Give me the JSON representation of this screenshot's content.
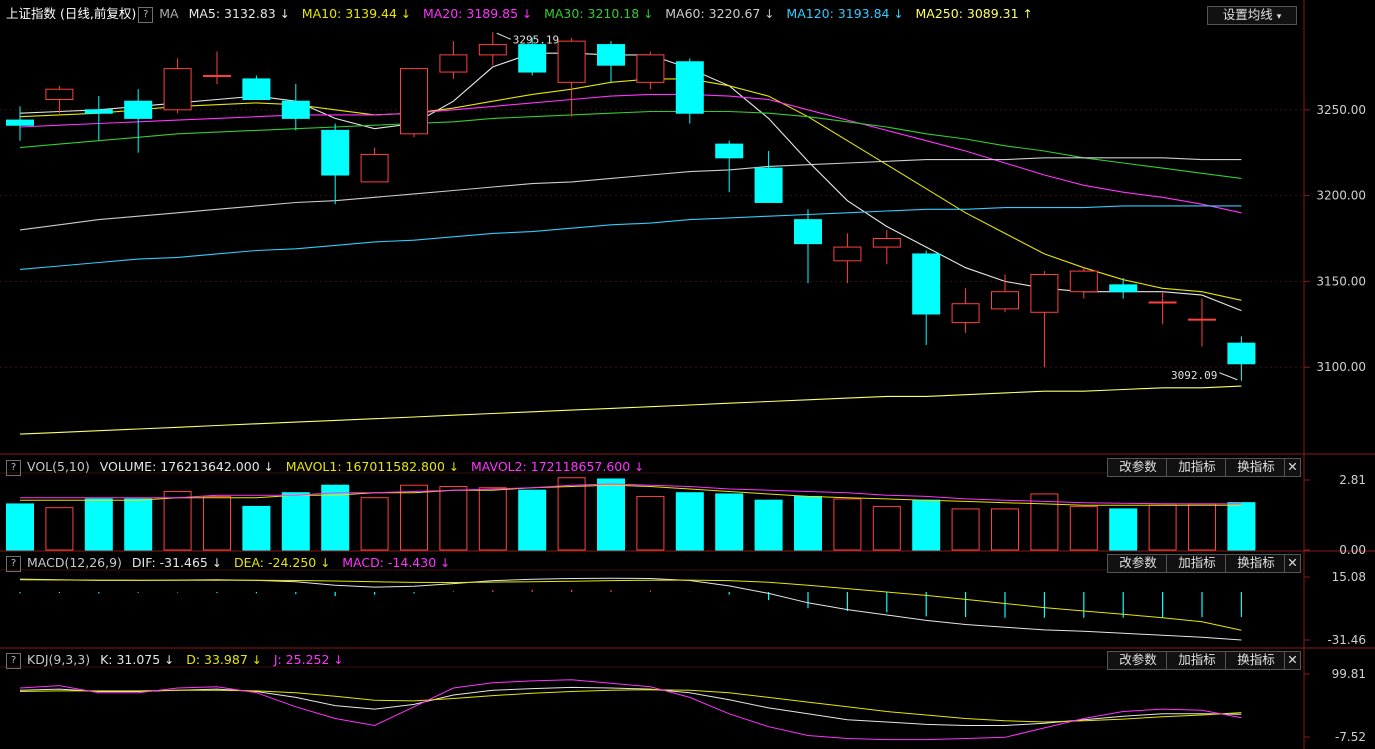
{
  "main": {
    "title": "上证指数",
    "subtitle": "(日线,前复权)",
    "ma_label": "MA",
    "ma_items": [
      {
        "label": "MA5: 3132.83",
        "arrow": "↓",
        "color": "#e6e6e6"
      },
      {
        "label": "MA10: 3139.44",
        "arrow": "↓",
        "color": "#e6e600"
      },
      {
        "label": "MA20: 3189.85",
        "arrow": "↓",
        "color": "#ff33ff"
      },
      {
        "label": "MA30: 3210.18",
        "arrow": "↓",
        "color": "#33cc33"
      },
      {
        "label": "MA60: 3220.67",
        "arrow": "↓",
        "color": "#cccccc"
      },
      {
        "label": "MA120: 3193.84",
        "arrow": "↓",
        "color": "#33ccff"
      },
      {
        "label": "MA250: 3089.31",
        "arrow": "↑",
        "color": "#ffff66"
      }
    ],
    "settings_button": "设置均线",
    "help_mark": "?"
  },
  "vol_panel": {
    "name": "VOL(5,10)",
    "items": [
      {
        "label": "VOLUME: 176213642.000",
        "arrow": "↓",
        "color": "#e6e6e6"
      },
      {
        "label": "MAVOL1: 167011582.800",
        "arrow": "↓",
        "color": "#e6e600"
      },
      {
        "label": "MAVOL2: 172118657.600",
        "arrow": "↓",
        "color": "#ff33ff"
      }
    ]
  },
  "macd_panel": {
    "name": "MACD(12,26,9)",
    "items": [
      {
        "label": "DIF: -31.465",
        "arrow": "↓",
        "color": "#e6e6e6"
      },
      {
        "label": "DEA: -24.250",
        "arrow": "↓",
        "color": "#e6e600"
      },
      {
        "label": "MACD: -14.430",
        "arrow": "↓",
        "color": "#ff33ff"
      }
    ]
  },
  "kdj_panel": {
    "name": "KDJ(9,3,3)",
    "items": [
      {
        "label": "K: 31.075",
        "arrow": "↓",
        "color": "#e6e6e6"
      },
      {
        "label": "D: 33.987",
        "arrow": "↓",
        "color": "#e6e600"
      },
      {
        "label": "J: 25.252",
        "arrow": "↓",
        "color": "#ff33ff"
      }
    ]
  },
  "panel_buttons": {
    "param": "改参数",
    "add": "加指标",
    "switch": "换指标",
    "close": "✕"
  },
  "colors": {
    "up": "#ff4040",
    "down": "#00ffff",
    "grid": "#3a1010",
    "axis": "#8b1a1a"
  },
  "chart_data": [
    {
      "type": "candlestick",
      "title": "上证指数 (日线,前复权)",
      "ylim": [
        3050,
        3300
      ],
      "y_ticks": [
        "3250.00",
        "3200.00",
        "3150.00",
        "3100.00"
      ],
      "y_tick_values": [
        3250,
        3200,
        3150,
        3100
      ],
      "annotations": [
        {
          "text": "3295.19",
          "index": 12,
          "value": 3295.19
        },
        {
          "text": "3092.09",
          "index": 31,
          "value": 3092.09
        }
      ],
      "ohlc": [
        [
          3244,
          3252,
          3232,
          3241
        ],
        [
          3256,
          3264,
          3248,
          3262
        ],
        [
          3250,
          3258,
          3232,
          3248
        ],
        [
          3255,
          3262,
          3225,
          3245
        ],
        [
          3250,
          3280,
          3248,
          3274
        ],
        [
          3270,
          3284,
          3265,
          3270
        ],
        [
          3268,
          3270,
          3258,
          3256
        ],
        [
          3255,
          3265,
          3238,
          3245
        ],
        [
          3238,
          3242,
          3195,
          3212
        ],
        [
          3208,
          3228,
          3208,
          3224
        ],
        [
          3236,
          3274,
          3234,
          3274
        ],
        [
          3272,
          3290,
          3268,
          3282
        ],
        [
          3282,
          3295.19,
          3276,
          3288
        ],
        [
          3288,
          3292,
          3270,
          3272
        ],
        [
          3266,
          3292,
          3246,
          3290
        ],
        [
          3288,
          3290,
          3266,
          3276
        ],
        [
          3266,
          3284,
          3262,
          3282
        ],
        [
          3278,
          3280,
          3242,
          3248
        ],
        [
          3230,
          3232,
          3202,
          3222
        ],
        [
          3216,
          3226,
          3196,
          3196
        ],
        [
          3186,
          3192,
          3149,
          3172
        ],
        [
          3162,
          3178,
          3149,
          3170
        ],
        [
          3170,
          3180,
          3160,
          3175
        ],
        [
          3166,
          3168,
          3113,
          3131
        ],
        [
          3126,
          3146,
          3120,
          3137
        ],
        [
          3134,
          3154,
          3132,
          3144
        ],
        [
          3132,
          3156,
          3100,
          3154
        ],
        [
          3144,
          3158,
          3140,
          3156
        ],
        [
          3148,
          3152,
          3140,
          3144
        ],
        [
          3138,
          3144,
          3125,
          3138
        ],
        [
          3128,
          3140,
          3112,
          3128
        ],
        [
          3114,
          3118,
          3092.09,
          3102
        ]
      ],
      "series": [
        {
          "name": "MA5",
          "color": "#e6e6e6",
          "values": [
            3248,
            3249,
            3250,
            3252,
            3254,
            3256,
            3258,
            3255,
            3245,
            3239,
            3242,
            3255,
            3275,
            3283,
            3283,
            3282,
            3282,
            3274,
            3264,
            3245,
            3220,
            3197,
            3182,
            3170,
            3158,
            3150,
            3146,
            3144,
            3144,
            3144,
            3142,
            3133
          ]
        },
        {
          "name": "MA10",
          "color": "#e6e600",
          "values": [
            3246,
            3247,
            3248,
            3250,
            3252,
            3253,
            3254,
            3253,
            3250,
            3247,
            3248,
            3251,
            3255,
            3259,
            3262,
            3266,
            3268,
            3268,
            3264,
            3258,
            3246,
            3232,
            3218,
            3204,
            3190,
            3178,
            3166,
            3158,
            3151,
            3146,
            3144,
            3139
          ]
        },
        {
          "name": "MA20",
          "color": "#ff33ff",
          "values": [
            3240,
            3241,
            3242,
            3243,
            3244,
            3245,
            3246,
            3247,
            3247,
            3247,
            3248,
            3250,
            3252,
            3254,
            3256,
            3258,
            3259,
            3259,
            3258,
            3256,
            3250,
            3244,
            3238,
            3232,
            3226,
            3219,
            3212,
            3206,
            3202,
            3199,
            3195,
            3190
          ]
        },
        {
          "name": "MA30",
          "color": "#33cc33",
          "values": [
            3228,
            3230,
            3232,
            3234,
            3236,
            3237,
            3238,
            3239,
            3240,
            3241,
            3242,
            3243,
            3245,
            3246,
            3247,
            3248,
            3249,
            3249,
            3249,
            3248,
            3246,
            3243,
            3240,
            3236,
            3233,
            3229,
            3226,
            3222,
            3219,
            3216,
            3213,
            3210
          ]
        },
        {
          "name": "MA60",
          "color": "#cccccc",
          "values": [
            3180,
            3183,
            3186,
            3188,
            3190,
            3192,
            3194,
            3196,
            3197,
            3199,
            3201,
            3203,
            3205,
            3207,
            3208,
            3210,
            3212,
            3214,
            3215,
            3217,
            3218,
            3219,
            3220,
            3221,
            3221,
            3221,
            3222,
            3222,
            3222,
            3222,
            3221,
            3221
          ]
        },
        {
          "name": "MA120",
          "color": "#33ccff",
          "values": [
            3157,
            3159,
            3161,
            3163,
            3164,
            3166,
            3168,
            3169,
            3171,
            3173,
            3174,
            3176,
            3178,
            3179,
            3181,
            3183,
            3184,
            3186,
            3187,
            3188,
            3189,
            3190,
            3191,
            3192,
            3192,
            3193,
            3193,
            3193,
            3194,
            3194,
            3194,
            3194
          ]
        },
        {
          "name": "MA250",
          "color": "#ffff66",
          "values": [
            3061,
            3062,
            3063,
            3064,
            3065,
            3066,
            3067,
            3068,
            3069,
            3070,
            3071,
            3072,
            3073,
            3074,
            3075,
            3076,
            3077,
            3078,
            3079,
            3080,
            3081,
            3082,
            3083,
            3083,
            3084,
            3085,
            3086,
            3086,
            3087,
            3088,
            3088,
            3089
          ]
        }
      ]
    },
    {
      "type": "bar",
      "title": "VOL(5,10)",
      "ylim": [
        0,
        2.81
      ],
      "y_ticks": [
        "2.81",
        "0.00"
      ],
      "values": [
        1.85,
        1.7,
        2.05,
        2.05,
        2.35,
        2.15,
        1.75,
        2.3,
        2.6,
        2.1,
        2.6,
        2.55,
        2.5,
        2.4,
        2.9,
        2.85,
        2.15,
        2.3,
        2.25,
        2.0,
        2.15,
        2.05,
        1.75,
        2.0,
        1.65,
        1.65,
        2.25,
        1.75,
        1.65,
        1.8,
        1.85,
        1.9
      ],
      "series": [
        {
          "name": "MAVOL1",
          "color": "#e6e600",
          "values": [
            2.0,
            2.0,
            2.0,
            2.0,
            2.1,
            2.1,
            2.1,
            2.2,
            2.2,
            2.3,
            2.3,
            2.4,
            2.4,
            2.5,
            2.55,
            2.6,
            2.55,
            2.45,
            2.35,
            2.25,
            2.15,
            2.1,
            2.05,
            2.0,
            1.95,
            1.9,
            1.85,
            1.8,
            1.8,
            1.8,
            1.8,
            1.8
          ]
        },
        {
          "name": "MAVOL2",
          "color": "#ff33ff",
          "values": [
            2.1,
            2.1,
            2.1,
            2.1,
            2.1,
            2.2,
            2.2,
            2.2,
            2.3,
            2.3,
            2.35,
            2.4,
            2.45,
            2.5,
            2.6,
            2.65,
            2.6,
            2.55,
            2.45,
            2.4,
            2.35,
            2.3,
            2.2,
            2.15,
            2.05,
            2.0,
            1.95,
            1.9,
            1.88,
            1.86,
            1.85,
            1.85
          ]
        }
      ]
    },
    {
      "type": "bar",
      "title": "MACD(12,26,9)",
      "ylim": [
        -31.46,
        15.08
      ],
      "y_ticks": [
        "15.08",
        "-31.46"
      ],
      "zero": 4.0,
      "values": [
        3.0,
        3.2,
        3.0,
        3.4,
        3.6,
        3.2,
        3.0,
        2.4,
        1.0,
        2.0,
        3.0,
        4.6,
        5.4,
        5.6,
        5.6,
        5.4,
        5.0,
        4.2,
        2.0,
        -2.0,
        -8.0,
        -10.0,
        -11.0,
        -14.0,
        -14.5,
        -15.0,
        -15.0,
        -15.0,
        -15.0,
        -14.8,
        -14.6,
        -14.43
      ],
      "series": [
        {
          "name": "DIF",
          "color": "#e6e6e6",
          "values": [
            13.5,
            13.0,
            12.6,
            12.6,
            12.8,
            13.0,
            12.6,
            11.6,
            9.0,
            7.6,
            8.2,
            10.2,
            12.4,
            13.4,
            14.0,
            14.2,
            14.0,
            12.5,
            8.5,
            3.0,
            -4.0,
            -9.0,
            -13.0,
            -17.0,
            -20.0,
            -22.0,
            -24.0,
            -25.0,
            -26.5,
            -28.0,
            -29.5,
            -31.465
          ]
        },
        {
          "name": "DEA",
          "color": "#e6e600",
          "values": [
            13.0,
            12.9,
            12.8,
            12.7,
            12.7,
            12.7,
            12.7,
            12.5,
            12.1,
            11.6,
            11.1,
            11.0,
            11.3,
            11.6,
            12.0,
            12.4,
            12.7,
            12.8,
            12.4,
            11.2,
            9.0,
            6.5,
            4.0,
            1.5,
            -1.5,
            -4.5,
            -7.5,
            -10.0,
            -12.5,
            -15.0,
            -18.0,
            -24.25
          ]
        }
      ]
    },
    {
      "type": "line",
      "title": "KDJ(9,3,3)",
      "ylim": [
        -7.52,
        99.81
      ],
      "y_ticks": [
        "99.81",
        "-7.52"
      ],
      "series": [
        {
          "name": "K",
          "color": "#e6e6e6",
          "values": [
            72,
            74,
            70,
            70,
            72,
            74,
            70,
            60,
            46,
            40,
            48,
            64,
            72,
            75,
            77,
            76,
            74,
            68,
            56,
            42,
            32,
            22,
            18,
            14,
            12,
            12,
            16,
            22,
            28,
            32,
            32,
            31.075
          ]
        },
        {
          "name": "D",
          "color": "#e6e600",
          "values": [
            70,
            71,
            71,
            71,
            72,
            72,
            71,
            68,
            62,
            55,
            54,
            58,
            63,
            67,
            70,
            72,
            73,
            72,
            68,
            60,
            52,
            44,
            36,
            30,
            24,
            20,
            18,
            20,
            23,
            27,
            30,
            33.987
          ]
        },
        {
          "name": "J",
          "color": "#ff33ff",
          "values": [
            76,
            80,
            68,
            68,
            76,
            78,
            68,
            44,
            24,
            12,
            44,
            76,
            85,
            88,
            90,
            84,
            78,
            60,
            32,
            10,
            -5,
            -10,
            -12,
            -12,
            -10,
            -8,
            8,
            24,
            36,
            40,
            38,
            25.252
          ]
        }
      ]
    }
  ]
}
